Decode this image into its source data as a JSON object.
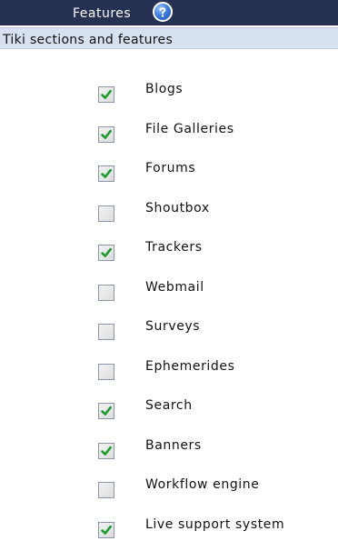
{
  "header": {
    "title": "Features",
    "help_icon": "question-mark-icon",
    "background_color": "#273153"
  },
  "section": {
    "title": "Tiki sections and features",
    "background_color": "#d7e1ef"
  },
  "check_color": "#1e9b2e",
  "features": [
    {
      "label": "Blogs",
      "checked": true
    },
    {
      "label": "File Galleries",
      "checked": true
    },
    {
      "label": "Forums",
      "checked": true
    },
    {
      "label": "Shoutbox",
      "checked": false
    },
    {
      "label": "Trackers",
      "checked": true
    },
    {
      "label": "Webmail",
      "checked": false
    },
    {
      "label": "Surveys",
      "checked": false
    },
    {
      "label": "Ephemerides",
      "checked": false
    },
    {
      "label": "Search",
      "checked": true
    },
    {
      "label": "Banners",
      "checked": true
    },
    {
      "label": "Workflow engine",
      "checked": false
    },
    {
      "label": "Live support system",
      "checked": true
    }
  ]
}
